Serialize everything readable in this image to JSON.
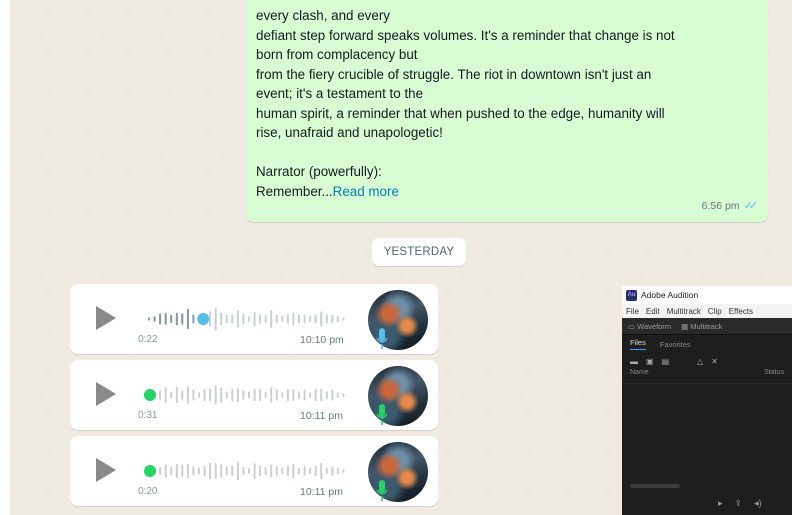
{
  "chat": {
    "outgoing": {
      "lines": [
        "every clash, and every",
        "defiant step forward speaks volumes. It's a reminder that change is not",
        "born from complacency but",
        "from the fiery crucible of struggle. The riot in downtown isn't just an",
        "event; it's a testament to the",
        "human spirit, a reminder that when pushed to the edge, humanity will",
        "rise, unafraid and unapologetic!",
        "",
        "Narrator (powerfully):"
      ],
      "last_line_prefix": "Remember...",
      "read_more": "Read more",
      "time": "6:56 pm",
      "ticks": "✓✓"
    },
    "date_chip": "YESTERDAY",
    "voice_notes": [
      {
        "duration": "0:22",
        "time": "10:10 pm",
        "progress": 0.28,
        "dot_color": "#53bdeb",
        "mic_color": "#53bdeb"
      },
      {
        "duration": "0:31",
        "time": "10:11 pm",
        "progress": 0.0,
        "dot_color": "#25d366",
        "mic_color": "#25d366"
      },
      {
        "duration": "0:20",
        "time": "10:11 pm",
        "progress": 0.0,
        "dot_color": "#25d366",
        "mic_color": "#25d366"
      }
    ]
  },
  "audition": {
    "title": "Adobe Audition",
    "logo": "Au",
    "menu": [
      "File",
      "Edit",
      "Multitrack",
      "Clip",
      "Effects"
    ],
    "toolbar": [
      "Waveform",
      "Multitrack"
    ],
    "panel_tabs": [
      "Files",
      "Favorites"
    ],
    "columns": [
      "Name",
      "Status"
    ]
  },
  "colors": {
    "outgoing_bg": "#d9fdd3",
    "link": "#027eb5",
    "ticks": "#53bdeb"
  }
}
